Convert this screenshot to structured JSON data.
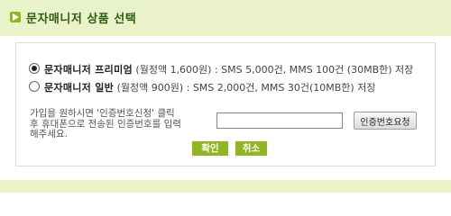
{
  "header": {
    "title": "문자매니저 상품 선택"
  },
  "options": [
    {
      "name": "문자매니저 프리미엄",
      "desc": " (월정액 1,600원) : SMS 5,000건, MMS 100건 (30MB한) 저장",
      "selected": true
    },
    {
      "name": "문자매니저 일반",
      "desc": " (월정액 900원) : SMS 2,000건, MMS 30건(10MB한) 저장",
      "selected": false
    }
  ],
  "auth": {
    "guide_line1": "가입을 원하시면 '인증번호신청' 클릭",
    "guide_line2": "후 휴대폰으로 전송된 인증번호를 입력",
    "guide_line3": "해주세요.",
    "input_value": "",
    "request_label": "인증번호요청"
  },
  "actions": {
    "ok_label": "확인",
    "cancel_label": "취소"
  },
  "colors": {
    "accent": "#8fb820",
    "header_bg": "#eaf2c9",
    "title_text": "#2f5a12"
  }
}
